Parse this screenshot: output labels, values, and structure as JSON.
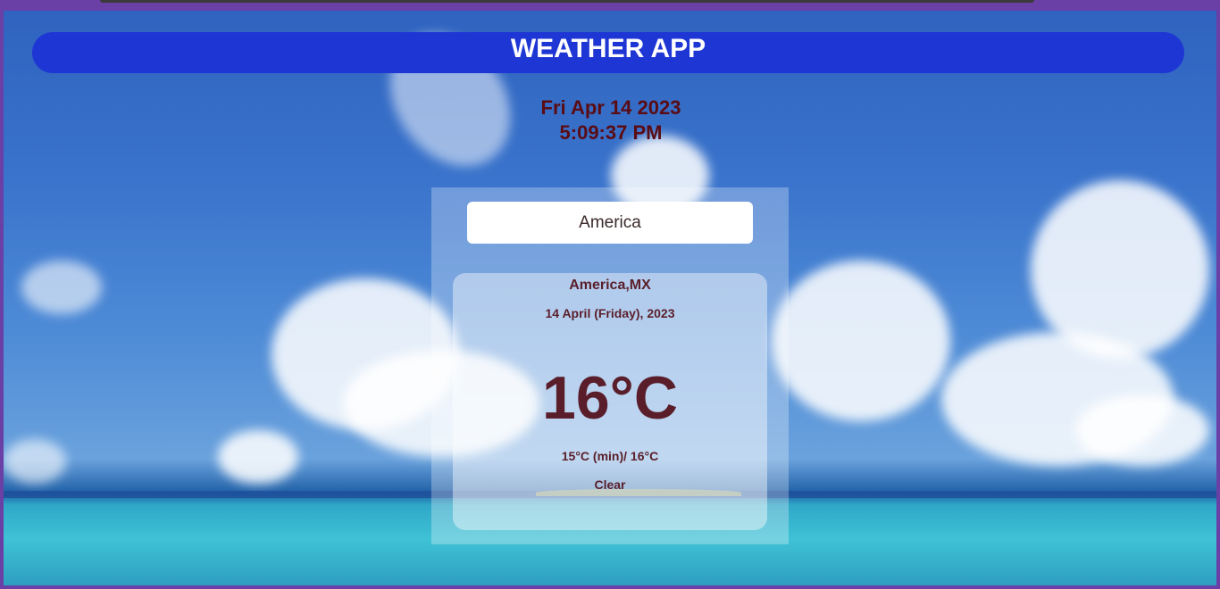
{
  "app": {
    "title": "WEATHER APP"
  },
  "clock": {
    "date": "Fri Apr 14 2023",
    "time": "5:09:37 PM"
  },
  "search": {
    "value": "America"
  },
  "weather": {
    "location": "America,MX",
    "date": "14 April (Friday), 2023",
    "temperature": "16°C",
    "min_max": "15°C (min)/ 16°C",
    "condition": "Clear"
  },
  "colors": {
    "header": "#1e36d4",
    "text_dark": "#5a0c14",
    "card_text": "#5a1e2a"
  }
}
